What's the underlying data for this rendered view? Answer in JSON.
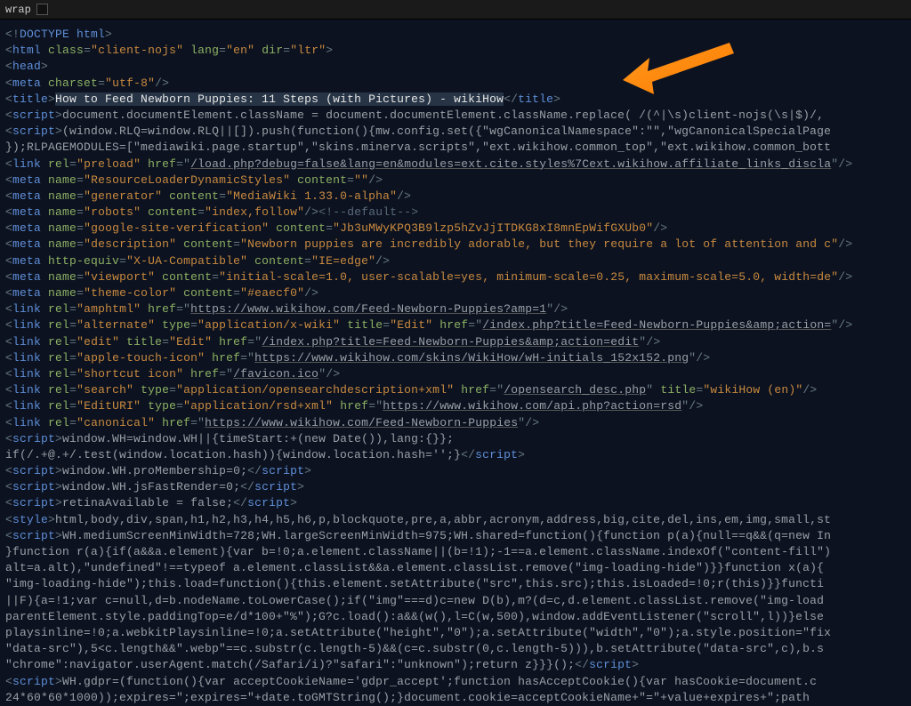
{
  "toolbar": {
    "wrap_label": "wrap"
  },
  "annotation_arrow": {
    "semantic": "attention-arrow",
    "target": "title-tag"
  },
  "lines": [
    {
      "kind": "doctype",
      "text": "<!DOCTYPE html>"
    },
    {
      "kind": "open",
      "tag": "html",
      "attrs": [
        [
          "class",
          "client-nojs"
        ],
        [
          "lang",
          "en"
        ],
        [
          "dir",
          "ltr"
        ]
      ]
    },
    {
      "kind": "open",
      "tag": "head"
    },
    {
      "kind": "self",
      "tag": "meta",
      "attrs": [
        [
          "charset",
          "utf-8"
        ]
      ]
    },
    {
      "kind": "el",
      "tag": "title",
      "inner": "How to Feed Newborn Puppies: 11 Steps (with Pictures) - wikiHow",
      "selected": true
    },
    {
      "kind": "script",
      "body": "document.documentElement.className = document.documentElement.className.replace( /(^|\\s)client-nojs(\\s|$)/, "
    },
    {
      "kind": "script",
      "body": "(window.RLQ=window.RLQ||[]).push(function(){mw.config.set({\"wgCanonicalNamespace\":\"\",\"wgCanonicalSpecialPage",
      "truncated": true
    },
    {
      "kind": "rawtext",
      "text": "});RLPAGEMODULES=[\"mediawiki.page.startup\",\"skins.minerva.scripts\",\"ext.wikihow.common_top\",\"ext.wikihow.common_bott",
      "truncated": true
    },
    {
      "kind": "self",
      "tag": "link",
      "attrs": [
        [
          "rel",
          "preload"
        ],
        [
          "href",
          "/load.php?debug=false&lang=en&modules=ext.cite.styles%7Cext.wikihow.affiliate_links_discla"
        ]
      ],
      "link_attr": "href",
      "truncated": true
    },
    {
      "kind": "self",
      "tag": "meta",
      "attrs": [
        [
          "name",
          "ResourceLoaderDynamicStyles"
        ],
        [
          "content",
          ""
        ]
      ]
    },
    {
      "kind": "self",
      "tag": "meta",
      "attrs": [
        [
          "name",
          "generator"
        ],
        [
          "content",
          "MediaWiki 1.33.0-alpha"
        ]
      ]
    },
    {
      "kind": "self_cmt",
      "tag": "meta",
      "attrs": [
        [
          "name",
          "robots"
        ],
        [
          "content",
          "index,follow"
        ]
      ],
      "comment": "<!--default-->"
    },
    {
      "kind": "self",
      "tag": "meta",
      "attrs": [
        [
          "name",
          "google-site-verification"
        ],
        [
          "content",
          "Jb3uMWyKPQ3B9lzp5hZvJjITDKG8xI8mnEpWifGXUb0"
        ]
      ]
    },
    {
      "kind": "self",
      "tag": "meta",
      "attrs": [
        [
          "name",
          "description"
        ],
        [
          "content",
          "Newborn puppies are incredibly adorable, but they require a lot of attention and c"
        ]
      ],
      "truncated": true
    },
    {
      "kind": "self",
      "tag": "meta",
      "attrs": [
        [
          "http-equiv",
          "X-UA-Compatible"
        ],
        [
          "content",
          "IE=edge"
        ]
      ]
    },
    {
      "kind": "self",
      "tag": "meta",
      "attrs": [
        [
          "name",
          "viewport"
        ],
        [
          "content",
          "initial-scale=1.0, user-scalable=yes, minimum-scale=0.25, maximum-scale=5.0, width=de"
        ]
      ],
      "truncated": true
    },
    {
      "kind": "self",
      "tag": "meta",
      "attrs": [
        [
          "name",
          "theme-color"
        ],
        [
          "content",
          "#eaecf0"
        ]
      ]
    },
    {
      "kind": "self",
      "tag": "link",
      "attrs": [
        [
          "rel",
          "amphtml"
        ],
        [
          "href",
          "https://www.wikihow.com/Feed-Newborn-Puppies?amp=1"
        ]
      ],
      "link_attr": "href"
    },
    {
      "kind": "self",
      "tag": "link",
      "attrs": [
        [
          "rel",
          "alternate"
        ],
        [
          "type",
          "application/x-wiki"
        ],
        [
          "title",
          "Edit"
        ],
        [
          "href",
          "/index.php?title=Feed-Newborn-Puppies&amp;action="
        ]
      ],
      "link_attr": "href",
      "truncated": true
    },
    {
      "kind": "self",
      "tag": "link",
      "attrs": [
        [
          "rel",
          "edit"
        ],
        [
          "title",
          "Edit"
        ],
        [
          "href",
          "/index.php?title=Feed-Newborn-Puppies&amp;action=edit"
        ]
      ],
      "link_attr": "href"
    },
    {
      "kind": "self",
      "tag": "link",
      "attrs": [
        [
          "rel",
          "apple-touch-icon"
        ],
        [
          "href",
          "https://www.wikihow.com/skins/WikiHow/wH-initials_152x152.png"
        ]
      ],
      "link_attr": "href"
    },
    {
      "kind": "self",
      "tag": "link",
      "attrs": [
        [
          "rel",
          "shortcut icon"
        ],
        [
          "href",
          "/favicon.ico"
        ]
      ],
      "link_attr": "href"
    },
    {
      "kind": "self",
      "tag": "link",
      "attrs": [
        [
          "rel",
          "search"
        ],
        [
          "type",
          "application/opensearchdescription+xml"
        ],
        [
          "href",
          "/opensearch_desc.php"
        ],
        [
          "title",
          "wikiHow (en)"
        ]
      ],
      "link_attr": "href"
    },
    {
      "kind": "self",
      "tag": "link",
      "attrs": [
        [
          "rel",
          "EditURI"
        ],
        [
          "type",
          "application/rsd+xml"
        ],
        [
          "href",
          "https://www.wikihow.com/api.php?action=rsd"
        ]
      ],
      "link_attr": "href"
    },
    {
      "kind": "self",
      "tag": "link",
      "attrs": [
        [
          "rel",
          "canonical"
        ],
        [
          "href",
          "https://www.wikihow.com/Feed-Newborn-Puppies"
        ]
      ],
      "link_attr": "href"
    },
    {
      "kind": "script",
      "body": "window.WH=window.WH||{timeStart:+(new Date()),lang:{}};"
    },
    {
      "kind": "rawclose",
      "text": "if(/.+@.+/.test(window.location.hash)){window.location.hash='';}",
      "closetag": "script"
    },
    {
      "kind": "scriptfull",
      "body": "window.WH.proMembership=0;"
    },
    {
      "kind": "scriptfull",
      "body": "window.WH.jsFastRender=0;"
    },
    {
      "kind": "scriptfull",
      "body": "retinaAvailable = false;"
    },
    {
      "kind": "style",
      "body": "html,body,div,span,h1,h2,h3,h4,h5,h6,p,blockquote,pre,a,abbr,acronym,address,big,cite,del,ins,em,img,small,st",
      "truncated": true
    },
    {
      "kind": "script",
      "body": "WH.mediumScreenMinWidth=728;WH.largeScreenMinWidth=975;WH.shared=function(){function p(a){null==q&&(q=new In",
      "truncated": true
    },
    {
      "kind": "rawtext",
      "text": "}function r(a){if(a&&a.element){var b=!0;a.element.className||(b=!1);-1==a.element.className.indexOf(\"content-fill\")",
      "truncated": true
    },
    {
      "kind": "rawtext",
      "text": "alt=a.alt),\"undefined\"!==typeof a.element.classList&&a.element.classList.remove(\"img-loading-hide\")}}function x(a){",
      "truncated": true
    },
    {
      "kind": "rawtext",
      "text": "\"img-loading-hide\");this.load=function(){this.element.setAttribute(\"src\",this.src);this.isLoaded=!0;r(this)}}functi",
      "truncated": true
    },
    {
      "kind": "rawtext",
      "text": "||F){a=!1;var c=null,d=b.nodeName.toLowerCase();if(\"img\"===d)c=new D(b),m?(d=c,d.element.classList.remove(\"img-load",
      "truncated": true
    },
    {
      "kind": "rawtext",
      "text": "parentElement.style.paddingTop=e/d*100+\"%\");G?c.load():a&&(w(),l=C(w,500),window.addEventListener(\"scroll\",l))}else",
      "truncated": true
    },
    {
      "kind": "rawtext",
      "text": "playsinline=!0;a.webkitPlaysinline=!0;a.setAttribute(\"height\",\"0\");a.setAttribute(\"width\",\"0\");a.style.position=\"fix",
      "truncated": true
    },
    {
      "kind": "rawclose",
      "text": "\"data-src\"),5<c.length&&\".webp\"==c.substr(c.length-5)&&(c=c.substr(0,c.length-5))),b.setAttribute(\"data-src\",c),b.s",
      "truncated": true
    },
    {
      "kind": "rawclose",
      "text": "\"chrome\":navigator.userAgent.match(/Safari/i)?\"safari\":\"unknown\");return z}}}();",
      "closetag": "script"
    },
    {
      "kind": "script",
      "body": "WH.gdpr=(function(){var acceptCookieName='gdpr_accept';function hasAcceptCookie(){var hasCookie=document.c",
      "truncated": true
    },
    {
      "kind": "rawtext",
      "text": "24*60*60*1000));expires=\";expires=\"+date.toGMTString();}document.cookie=acceptCookieName+\"=\"+value+expires+\";path",
      "truncated": true
    }
  ]
}
